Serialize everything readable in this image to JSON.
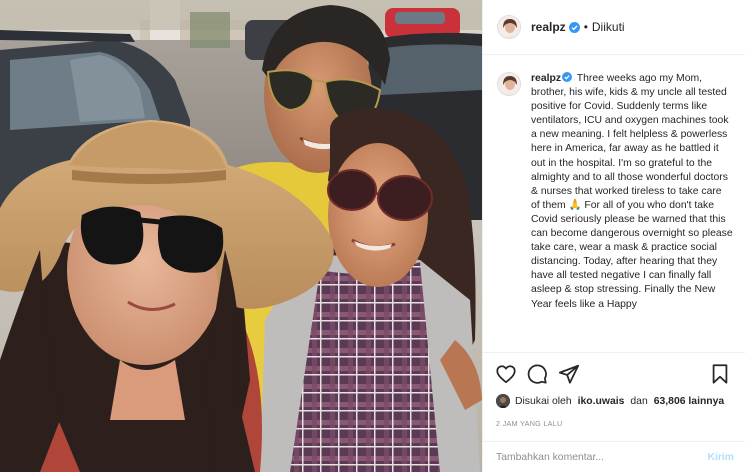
{
  "colors": {
    "verified_badge": "#3897f0",
    "text_primary": "#262626",
    "text_secondary": "#8e8e8e",
    "post_button_disabled": "#b2dffc",
    "border": "#efefef"
  },
  "header": {
    "username": "realpz",
    "verified": true,
    "separator": "•",
    "follow_status": "Diikuti"
  },
  "caption": {
    "username": "realpz",
    "text": "Three weeks ago my Mom, brother, his wife, kids & my uncle all tested positive for Covid. Suddenly terms like ventilators, ICU and oxygen machines took a new meaning. I felt helpless & powerless here in America, far away as he battled it out in the hospital. I'm so grateful to the almighty and to all those wonderful doctors & nurses that worked tireless to take care of them 🙏 For all of you who don't take Covid seriously please be warned that this can become dangerous overnight so please take care, wear a mask & practice social distancing. Today, after hearing that they have all tested negative I can finally fall asleep & stop stressing. Finally the New Year feels like a Happy"
  },
  "actions": {
    "icons": [
      "heart-icon",
      "comment-icon",
      "share-icon",
      "bookmark-icon"
    ]
  },
  "likes": {
    "prefix": "Disukai oleh",
    "first_user": "iko.uwais",
    "joiner": "dan",
    "others": "63,806 lainnya"
  },
  "timestamp": "2 JAM YANG LALU",
  "comment_box": {
    "placeholder": "Tambahkan komentar...",
    "post_label": "Kirim"
  }
}
